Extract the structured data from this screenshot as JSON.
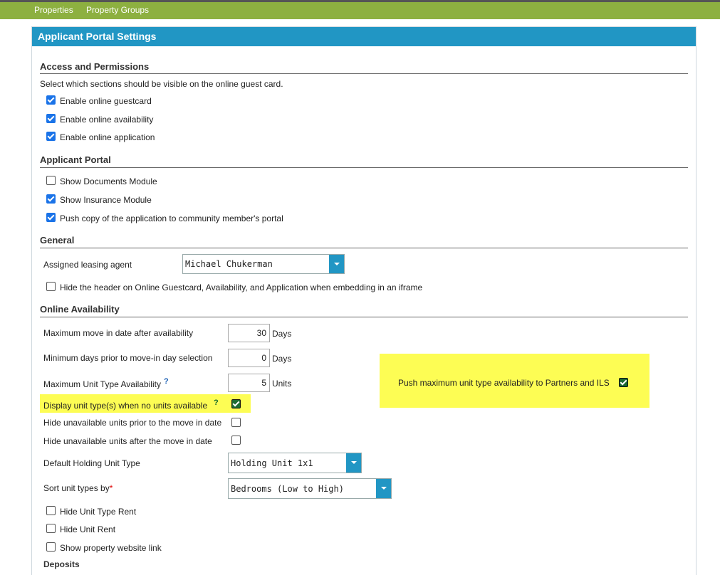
{
  "nav": {
    "items": [
      "Properties",
      "Property Groups"
    ]
  },
  "panel": {
    "title": "Applicant Portal Settings"
  },
  "access": {
    "title": "Access and Permissions",
    "description": "Select which sections should be visible on the online guest card.",
    "options": [
      {
        "label": "Enable online guestcard",
        "checked": true
      },
      {
        "label": "Enable online availability",
        "checked": true
      },
      {
        "label": "Enable online application",
        "checked": true
      }
    ]
  },
  "portal": {
    "title": "Applicant Portal",
    "options": [
      {
        "label": "Show Documents Module",
        "checked": false
      },
      {
        "label": "Show Insurance Module",
        "checked": true
      },
      {
        "label": "Push copy of the application to community member's portal",
        "checked": true
      }
    ]
  },
  "general": {
    "title": "General",
    "agent_label": "Assigned leasing agent",
    "agent_value": "Michael Chukerman",
    "hide_header_label": "Hide the header on Online Guestcard, Availability, and Application when embedding in an iframe",
    "hide_header_checked": false
  },
  "availability": {
    "title": "Online Availability",
    "max_move_label": "Maximum move in date after availability",
    "max_move_value": "30",
    "max_move_unit": "Days",
    "min_days_label": "Minimum days prior to move-in day selection",
    "min_days_value": "0",
    "min_days_unit": "Days",
    "max_unit_label": "Maximum Unit Type Availability",
    "max_unit_value": "5",
    "max_unit_unit": "Units",
    "help_mark": "?",
    "push_label": "Push maximum unit type availability to Partners and ILS",
    "push_checked": true,
    "display_label": "Display unit type(s) when no units available",
    "display_checked": true,
    "hide_prior_label": "Hide unavailable units prior to the move in date",
    "hide_prior_checked": false,
    "hide_after_label": "Hide unavailable units after the move in date",
    "hide_after_checked": false,
    "holding_label": "Default Holding Unit Type",
    "holding_value": "Holding Unit 1x1",
    "sort_label": "Sort unit types by",
    "sort_required": "*",
    "sort_value": "Bedrooms (Low to High)",
    "extra_options": [
      {
        "label": "Hide Unit Type Rent",
        "checked": false
      },
      {
        "label": "Hide Unit Rent",
        "checked": false
      },
      {
        "label": "Show property website link",
        "checked": false
      }
    ]
  },
  "deposits": {
    "title": "Deposits"
  },
  "colors": {
    "nav": "#8db040",
    "header": "#2196c4",
    "highlight": "#fdfd54",
    "check": "#1a73e8"
  }
}
